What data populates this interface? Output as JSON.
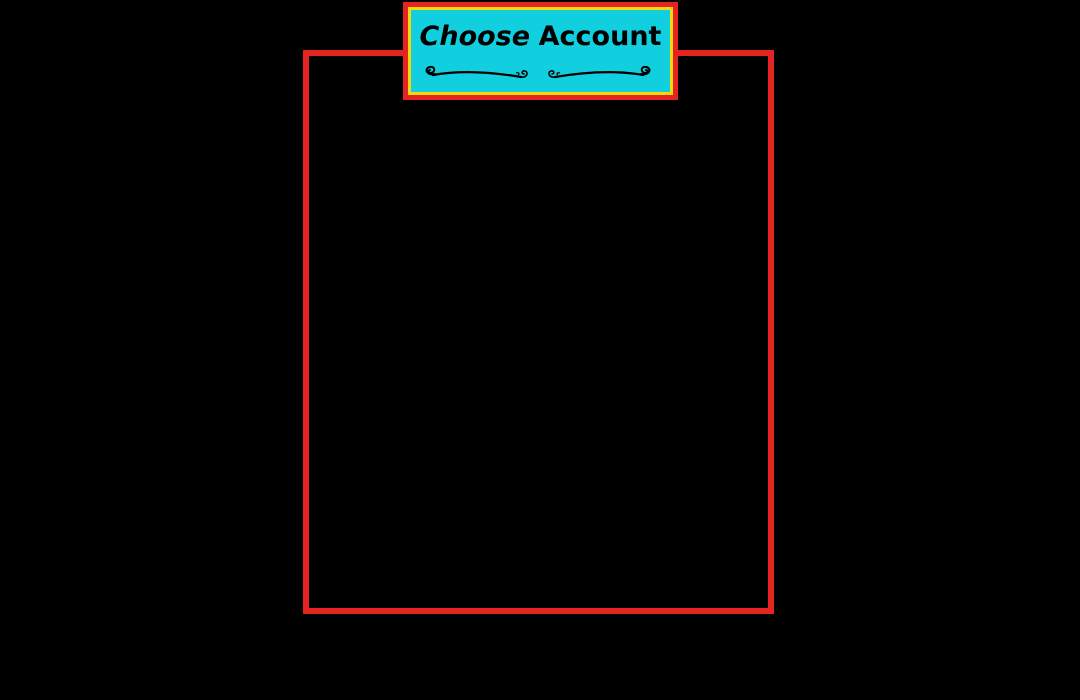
{
  "dialog": {
    "title_emphasis": "Choose",
    "title_rest": "Account",
    "accounts": []
  },
  "colors": {
    "background": "#000000",
    "frame_red": "#e52421",
    "badge_yellow": "#f5d90a",
    "badge_cyan": "#11cfdf",
    "title_text": "#000000"
  },
  "icons": {
    "left_ornament": "scroll-flourish-left-icon",
    "right_ornament": "scroll-flourish-right-icon"
  }
}
